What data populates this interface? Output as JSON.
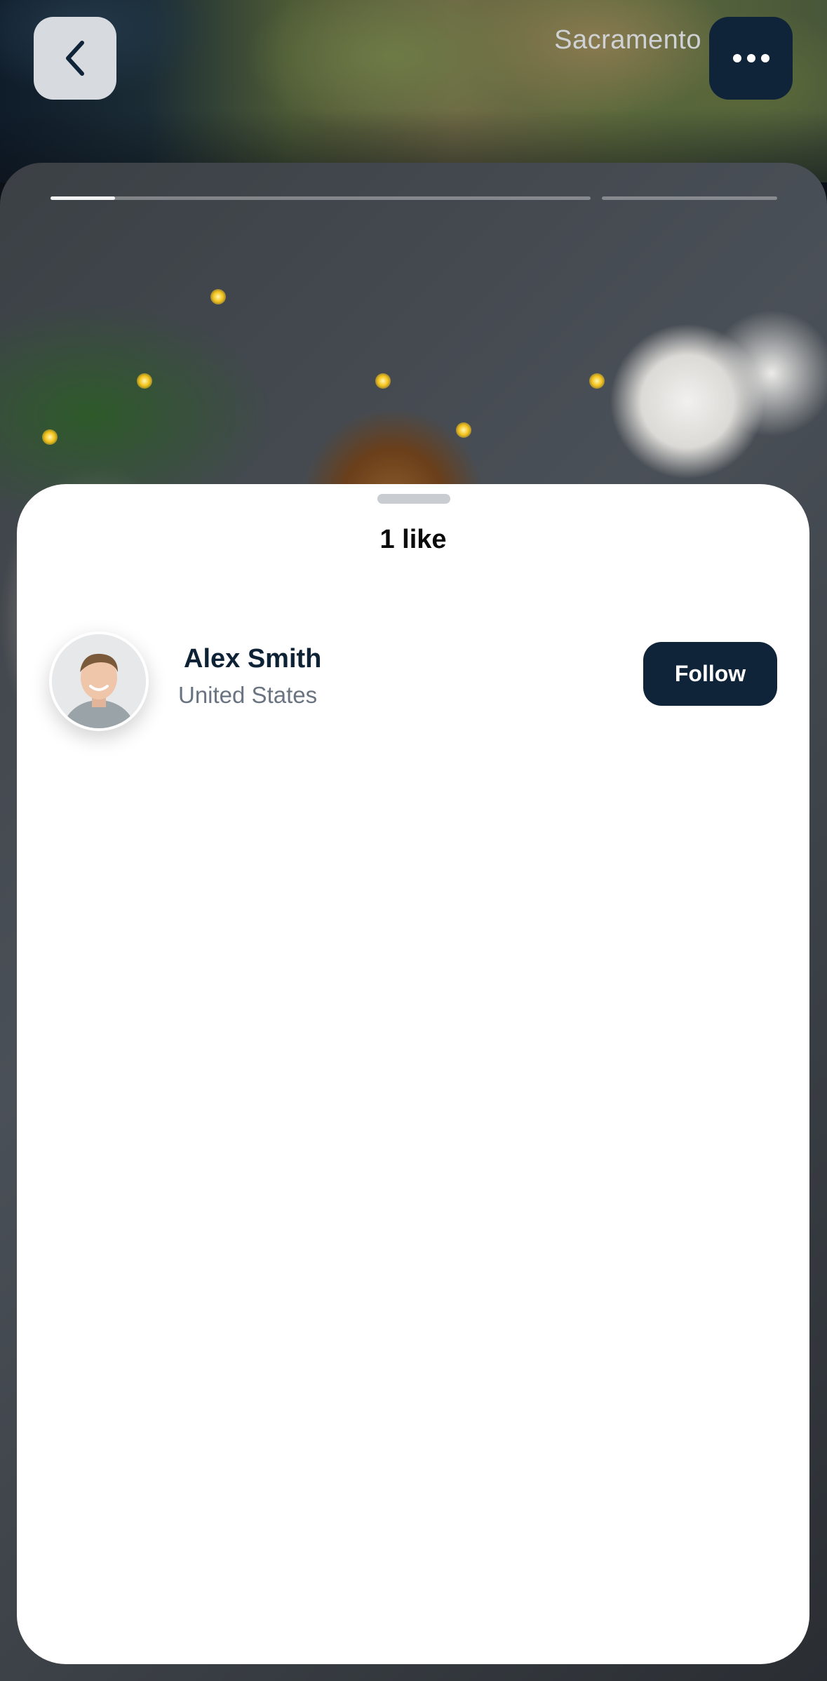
{
  "header": {
    "location_title": "Sacramento",
    "back_icon": "chevron-left-icon",
    "more_icon": "ellipsis-icon"
  },
  "story": {
    "progress_segments": 2,
    "active_segment_progress": 0.2
  },
  "likes_sheet": {
    "title": "1 like",
    "users": [
      {
        "name": "Alex Smith",
        "location": "United States",
        "follow_label": "Follow"
      }
    ]
  },
  "colors": {
    "brand_dark": "#0f2438",
    "name_text": "#0e2236",
    "secondary_text": "#6a7480"
  }
}
